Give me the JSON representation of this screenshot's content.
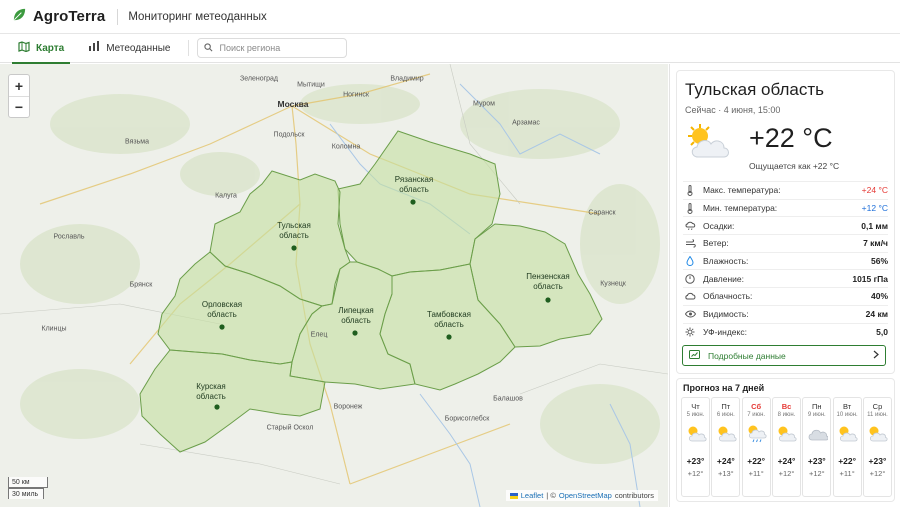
{
  "app": {
    "name": "AgroTerra",
    "subtitle": "Мониторинг метеоданных"
  },
  "nav": {
    "tab_map": "Карта",
    "tab_meteo": "Метеоданные",
    "search_placeholder": "Поиск региона"
  },
  "map": {
    "zoom_in": "+",
    "zoom_out": "−",
    "cities": {
      "zelenograd": "Зеленоград",
      "mytishchi": "Мытищи",
      "vladimir": "Владимир",
      "moskva": "Москва",
      "noginsk": "Ногинск",
      "murom": "Муром",
      "podolsk": "Подольск",
      "arzamas": "Арзамас",
      "vyazma": "Вязьма",
      "kolomna": "Коломна",
      "kaluga": "Калуга",
      "saransk": "Саранск",
      "roslavl": "Рославль",
      "bryansk": "Брянск",
      "kuznetsk": "Кузнецк",
      "klintsy": "Клинцы",
      "elets": "Елец",
      "voronezh": "Воронеж",
      "balashov": "Балашов",
      "borisoglebsk": "Борисоглебск",
      "stary_oskol": "Старый Оскол"
    },
    "regions": {
      "tula": "Тульская область",
      "ryazan": "Рязанская область",
      "orel": "Орловская область",
      "lipetsk": "Липецкая область",
      "tambov": "Тамбовская область",
      "penza": "Пензенская область",
      "kursk": "Курская область"
    },
    "scale_km": "50 км",
    "scale_mi": "30 миль",
    "attrib_leaflet": "Leaflet",
    "attrib_sep": "| ©",
    "attrib_osm": "OpenStreetMap",
    "attrib_contrib": "contributors"
  },
  "current": {
    "region": "Тульская область",
    "updated": "Сейчас · 4 июня, 15:00",
    "temp": "+22 °C",
    "feels": "Ощущается как +22 °C",
    "rows": [
      {
        "icon": "thermometer-icon",
        "label": "Макс. температура:",
        "value": "+24 °C"
      },
      {
        "icon": "thermometer-icon",
        "label": "Мин. температура:",
        "value": "+12 °C"
      },
      {
        "icon": "cloud-rain-icon",
        "label": "Осадки:",
        "value": "0,1 мм"
      },
      {
        "icon": "wind-icon",
        "label": "Ветер:",
        "value": "7 км/ч"
      },
      {
        "icon": "droplet-icon",
        "label": "Влажность:",
        "value": "56%"
      },
      {
        "icon": "gauge-icon",
        "label": "Давление:",
        "value": "1015 гПа"
      },
      {
        "icon": "cloud-icon",
        "label": "Облачность:",
        "value": "40%"
      },
      {
        "icon": "eye-icon",
        "label": "Видимость:",
        "value": "24 км"
      },
      {
        "icon": "sun-icon",
        "label": "УФ-индекс:",
        "value": "5,0"
      }
    ],
    "details_label": "Подробные данные"
  },
  "forecast": {
    "title": "Прогноз на 7 дней",
    "days": [
      {
        "name": "Чт",
        "date": "5 июн.",
        "icon": "partly-cloudy-icon",
        "hi": "+23°",
        "lo": "+12°"
      },
      {
        "name": "Пт",
        "date": "6 июн.",
        "icon": "partly-cloudy-icon",
        "hi": "+24°",
        "lo": "+13°"
      },
      {
        "name": "Сб",
        "date": "7 июн.",
        "icon": "rain-sun-icon",
        "hi": "+22°",
        "lo": "+11°"
      },
      {
        "name": "Вс",
        "date": "8 июн.",
        "icon": "partly-cloudy-icon",
        "hi": "+24°",
        "lo": "+12°"
      },
      {
        "name": "Пн",
        "date": "9 июн.",
        "icon": "cloud-icon",
        "hi": "+23°",
        "lo": "+12°"
      },
      {
        "name": "Вт",
        "date": "10 июн.",
        "icon": "partly-cloudy-icon",
        "hi": "+22°",
        "lo": "+11°"
      },
      {
        "name": "Ср",
        "date": "11 июн.",
        "icon": "partly-cloudy-icon",
        "hi": "+23°",
        "lo": "+12°"
      }
    ]
  },
  "colors": {
    "accent": "#2e7d32",
    "region_fill": "#c5dfa0",
    "hot": "#e53935",
    "cold": "#1e6fd9"
  }
}
